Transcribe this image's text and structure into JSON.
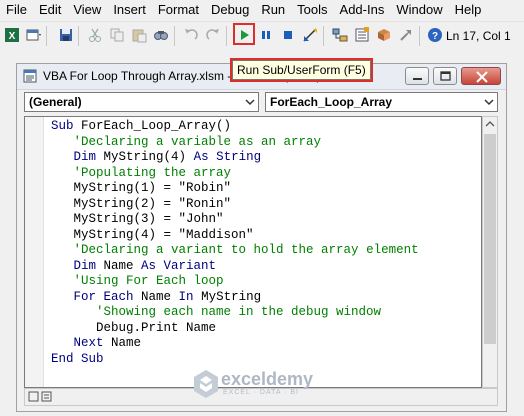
{
  "menubar": {
    "items": [
      "File",
      "Edit",
      "View",
      "Insert",
      "Format",
      "Debug",
      "Run",
      "Tools",
      "Add-Ins",
      "Window",
      "Help"
    ]
  },
  "toolbar": {
    "position_status": "Ln 17, Col 1",
    "tooltip": "Run Sub/UserForm (F5)",
    "icons": [
      "excel-icon",
      "insert-module-icon",
      "save-icon",
      "cut-icon",
      "copy-icon",
      "paste-icon",
      "find-icon",
      "undo-icon",
      "redo-icon",
      "run-icon",
      "break-icon",
      "reset-icon",
      "design-mode-icon",
      "project-explorer-icon",
      "properties-icon",
      "object-browser-icon",
      "toolbox-icon",
      "help-icon"
    ],
    "highlight_color": "#d9302c"
  },
  "window": {
    "title": "VBA For Loop Through Array.xlsm - Module1 (Code)",
    "object_combo": "(General)",
    "procedure_combo": "ForEach_Loop_Array"
  },
  "code": {
    "keyword_color": "#00007f",
    "comment_color": "#007f00",
    "lines": [
      {
        "kw1": "Sub",
        "text": " ForEach_Loop_Array()",
        "kw2": "",
        "tail": "",
        "comment": "",
        "indent": ""
      },
      {
        "kw1": "",
        "text": "",
        "kw2": "",
        "tail": "",
        "comment": "'Declaring a variable as an array",
        "indent": "   "
      },
      {
        "kw1": "Dim",
        "text": " MyString(4) ",
        "kw2": "As String",
        "tail": "",
        "comment": "",
        "indent": "   "
      },
      {
        "kw1": "",
        "text": "",
        "kw2": "",
        "tail": "",
        "comment": "'Populating the array",
        "indent": "   "
      },
      {
        "kw1": "",
        "text": "MyString(1) = \"Robin\"",
        "kw2": "",
        "tail": "",
        "comment": "",
        "indent": "   "
      },
      {
        "kw1": "",
        "text": "MyString(2) = \"Ronin\"",
        "kw2": "",
        "tail": "",
        "comment": "",
        "indent": "   "
      },
      {
        "kw1": "",
        "text": "MyString(3) = \"John\"",
        "kw2": "",
        "tail": "",
        "comment": "",
        "indent": "   "
      },
      {
        "kw1": "",
        "text": "MyString(4) = \"Maddison\"",
        "kw2": "",
        "tail": "",
        "comment": "",
        "indent": "   "
      },
      {
        "kw1": "",
        "text": "",
        "kw2": "",
        "tail": "",
        "comment": "'Declaring a variant to hold the array element",
        "indent": "   "
      },
      {
        "kw1": "Dim",
        "text": " Name ",
        "kw2": "As Variant",
        "tail": "",
        "comment": "",
        "indent": "   "
      },
      {
        "kw1": "",
        "text": "",
        "kw2": "",
        "tail": "",
        "comment": "'Using For Each loop",
        "indent": "   "
      },
      {
        "kw1": "For Each",
        "text": " Name ",
        "kw2": "In",
        "tail": " MyString",
        "comment": "",
        "indent": "   "
      },
      {
        "kw1": "",
        "text": "",
        "kw2": "",
        "tail": "",
        "comment": "'Showing each name in the debug window",
        "indent": "      "
      },
      {
        "kw1": "",
        "text": "Debug.Print Name",
        "kw2": "",
        "tail": "",
        "comment": "",
        "indent": "      "
      },
      {
        "kw1": "Next",
        "text": " Name",
        "kw2": "",
        "tail": "",
        "comment": "",
        "indent": "   "
      },
      {
        "kw1": "End Sub",
        "text": "",
        "kw2": "",
        "tail": "",
        "comment": "",
        "indent": ""
      }
    ]
  },
  "watermark": {
    "name": "exceldemy",
    "tagline": "EXCEL · DATA · BI"
  }
}
